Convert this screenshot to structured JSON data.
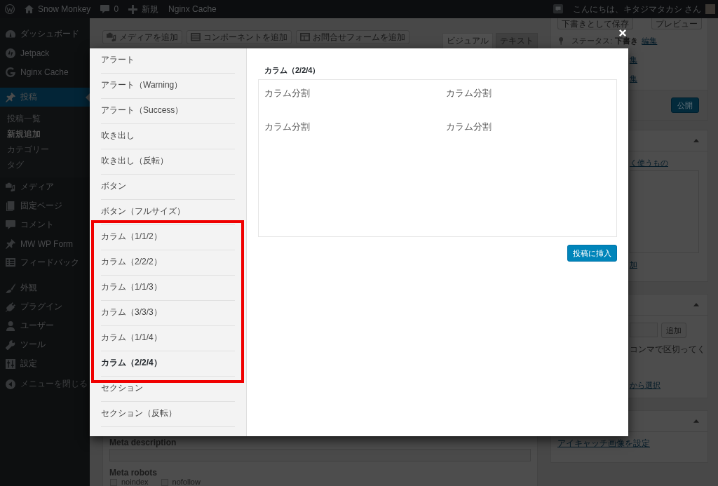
{
  "admin_bar": {
    "site": "Snow Monkey",
    "comments": "0",
    "new": "新規",
    "cache": "Nginx Cache",
    "greeting": "こんにちは、キタジマタカシ さん"
  },
  "sidebar": {
    "sections": [
      {
        "items": [
          {
            "label": "ダッシュボード",
            "selected": false
          },
          {
            "label": "Jetpack",
            "selected": false
          },
          {
            "label": "Nginx Cache",
            "selected": false
          }
        ]
      },
      {
        "items": [
          {
            "label": "投稿",
            "selected": true,
            "children": [
              {
                "label": "投稿一覧",
                "selected": false
              },
              {
                "label": "新規追加",
                "selected": true
              },
              {
                "label": "カテゴリー",
                "selected": false
              },
              {
                "label": "タグ",
                "selected": false
              }
            ]
          },
          {
            "label": "メディア",
            "selected": false
          },
          {
            "label": "固定ページ",
            "selected": false
          },
          {
            "label": "コメント",
            "selected": false
          },
          {
            "label": "MW WP Form",
            "selected": false
          },
          {
            "label": "フィードバック",
            "selected": false
          }
        ]
      },
      {
        "items": [
          {
            "label": "外観",
            "selected": false
          },
          {
            "label": "プラグイン",
            "selected": false
          },
          {
            "label": "ユーザー",
            "selected": false
          },
          {
            "label": "ツール",
            "selected": false
          },
          {
            "label": "設定",
            "selected": false
          }
        ]
      }
    ],
    "collapse": "メニューを閉じる"
  },
  "editor": {
    "toolbar": [
      "メディアを追加",
      "コンポーネントを追加",
      "お問合せフォームを追加"
    ],
    "tabs": [
      {
        "label": "ビジュアル",
        "selected": true
      },
      {
        "label": "テキスト",
        "selected": false
      }
    ]
  },
  "seo_box": {
    "description_label": "Meta description",
    "robots_label": "Meta robots",
    "robots": [
      {
        "label": "noindex",
        "checked": false
      },
      {
        "label": "nofollow",
        "checked": false
      }
    ]
  },
  "publish_box": {
    "buttons": [
      "下書きとして保存",
      "プレビュー"
    ],
    "status_label": "ステータス:",
    "status_value": "下書き",
    "status_link": "編集",
    "edit_links": [
      "集",
      "集"
    ],
    "publish_button": "公開"
  },
  "category_box": {
    "expanded": true,
    "tab": "く使うもの",
    "add_link": "加"
  },
  "tag_box": {
    "expanded": true,
    "add_button": "追加",
    "hint": "コンマで区切ってく",
    "choose_link": "から選択"
  },
  "featured_box": {
    "expanded": true,
    "link": "アイキャッチ画像を設定"
  },
  "modal": {
    "items": [
      {
        "label": "アラート",
        "selected": false,
        "highlighted": false
      },
      {
        "label": "アラート（Warning）",
        "selected": false,
        "highlighted": false
      },
      {
        "label": "アラート（Success）",
        "selected": false,
        "highlighted": false
      },
      {
        "label": "吹き出し",
        "selected": false,
        "highlighted": false
      },
      {
        "label": "吹き出し（反転）",
        "selected": false,
        "highlighted": false
      },
      {
        "label": "ボタン",
        "selected": false,
        "highlighted": false
      },
      {
        "label": "ボタン（フルサイズ）",
        "selected": false,
        "highlighted": false
      },
      {
        "label": "カラム（1/1/2）",
        "selected": false,
        "highlighted": true
      },
      {
        "label": "カラム（2/2/2）",
        "selected": false,
        "highlighted": true
      },
      {
        "label": "カラム（1/1/3）",
        "selected": false,
        "highlighted": true
      },
      {
        "label": "カラム（3/3/3）",
        "selected": false,
        "highlighted": true
      },
      {
        "label": "カラム（1/1/4）",
        "selected": false,
        "highlighted": true
      },
      {
        "label": "カラム（2/2/4）",
        "selected": true,
        "highlighted": true
      },
      {
        "label": "セクション",
        "selected": false,
        "highlighted": false
      },
      {
        "label": "セクション（反転）",
        "selected": false,
        "highlighted": false
      }
    ],
    "preview": {
      "title": "カラム（2/2/4）",
      "rows": [
        [
          "カラム分割",
          "カラム分割"
        ],
        [
          "カラム分割",
          "カラム分割"
        ]
      ]
    },
    "insert_button": "投稿に挿入"
  }
}
